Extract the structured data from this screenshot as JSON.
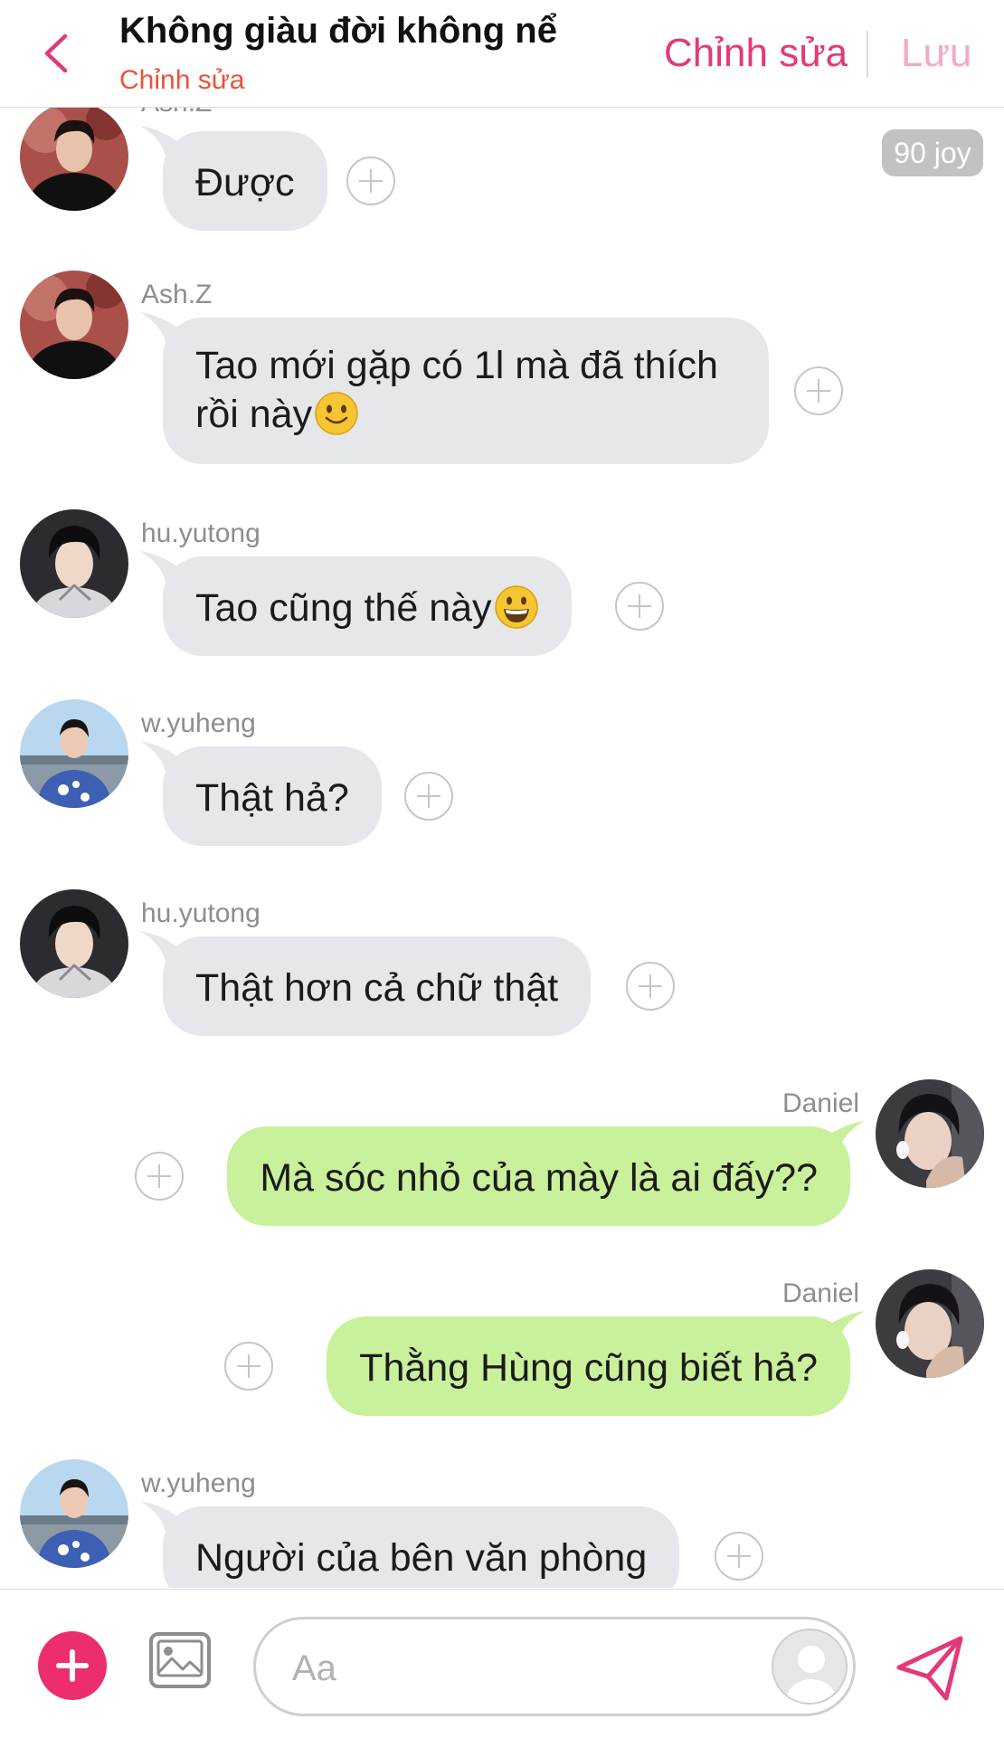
{
  "header": {
    "title": "Không giàu đời không nể",
    "subtitle": "Chỉnh sửa",
    "edit_label": "Chỉnh sửa",
    "save_label": "Lưu"
  },
  "joy_badge": "90 joy",
  "messages": [
    {
      "sender": "Ash.Z",
      "text": "Được",
      "direction": "incoming",
      "avatar": "ash-z-avatar"
    },
    {
      "sender": "Ash.Z",
      "text_line1": "Tao mới gặp có 1l mà đã thích",
      "text_line2": "rồi này",
      "emoji": "slightly-smiling-face",
      "direction": "incoming",
      "avatar": "ash-z-avatar"
    },
    {
      "sender": "hu.yutong",
      "text": "Tao cũng thế này",
      "emoji": "grinning-face",
      "direction": "incoming",
      "avatar": "hu-yutong-avatar"
    },
    {
      "sender": "w.yuheng",
      "text": "Thật hả?",
      "direction": "incoming",
      "avatar": "w-yuheng-avatar"
    },
    {
      "sender": "hu.yutong",
      "text": "Thật hơn cả chữ thật",
      "direction": "incoming",
      "avatar": "hu-yutong-avatar"
    },
    {
      "sender": "Daniel",
      "text": "Mà sóc nhỏ của mày là ai đấy??",
      "direction": "outgoing",
      "avatar": "daniel-avatar"
    },
    {
      "sender": "Daniel",
      "text": "Thằng Hùng cũng biết hả?",
      "direction": "outgoing",
      "avatar": "daniel-avatar"
    },
    {
      "sender": "w.yuheng",
      "text": "Người của bên văn phòng",
      "direction": "incoming",
      "avatar": "w-yuheng-avatar"
    }
  ],
  "composer": {
    "placeholder": "Aa"
  },
  "colors": {
    "accent": "#e3397a",
    "subtitle": "#e8533a",
    "incoming_bubble": "#e6e7ea",
    "outgoing_bubble": "#c9f09a"
  },
  "icons": [
    "chevron-left-icon",
    "plus-circle-icon",
    "image-icon",
    "user-placeholder-icon",
    "send-icon"
  ]
}
